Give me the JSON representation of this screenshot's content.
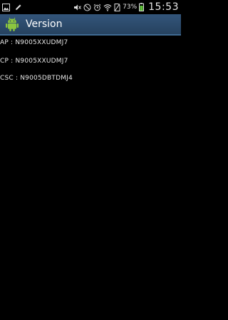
{
  "status_bar": {
    "battery_percent": "73%",
    "time": "15:53",
    "icons": [
      "image-icon",
      "pencil-icon",
      "mute-icon",
      "no-signal-icon",
      "alarm-icon",
      "wifi-icon",
      "no-sim-icon",
      "battery-icon"
    ]
  },
  "action_bar": {
    "title": "Version",
    "icon": "android-icon",
    "color": "#2c4a68"
  },
  "versions": [
    {
      "label": "AP",
      "separator": " : ",
      "value": "N9005XXUDMJ7"
    },
    {
      "label": "CP",
      "separator": " : ",
      "value": "N9005XXUDMJ7"
    },
    {
      "label": "CSC",
      "separator": " : ",
      "value": "N9005DBTDMJ4"
    }
  ]
}
